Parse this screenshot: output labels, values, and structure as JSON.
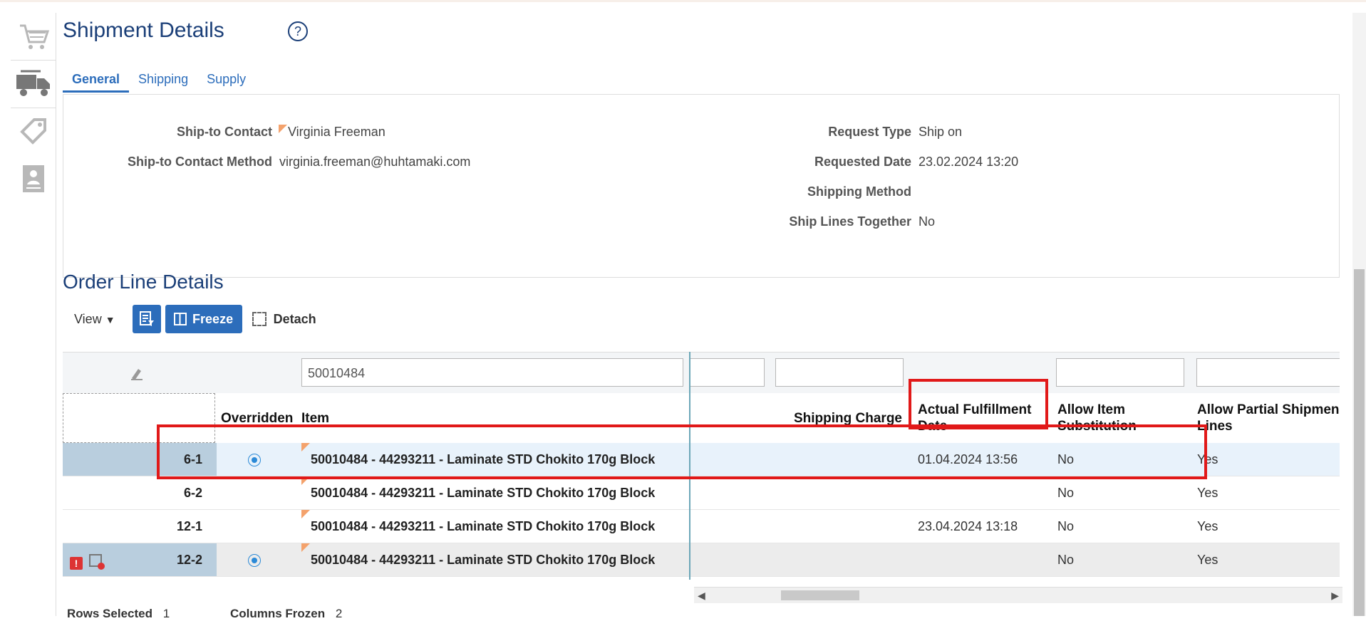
{
  "page": {
    "title": "Shipment Details",
    "help": "?"
  },
  "tabs": {
    "general": "General",
    "shipping": "Shipping",
    "supply": "Supply"
  },
  "details": {
    "ship_to_contact_label": "Ship-to Contact",
    "ship_to_contact_value": "Virginia Freeman",
    "ship_to_contact_method_label": "Ship-to Contact Method",
    "ship_to_contact_method_value": "virginia.freeman@huhtamaki.com",
    "request_type_label": "Request Type",
    "request_type_value": "Ship on",
    "requested_date_label": "Requested Date",
    "requested_date_value": "23.02.2024 13:20",
    "shipping_method_label": "Shipping Method",
    "ship_lines_together_label": "Ship Lines Together",
    "ship_lines_together_value": "No"
  },
  "order_lines": {
    "title": "Order Line Details",
    "toolbar": {
      "view": "View",
      "freeze": "Freeze",
      "detach": "Detach"
    },
    "filter": {
      "item_value": "50010484"
    },
    "headers": {
      "overridden": "Overridden",
      "item": "Item",
      "shipping_charge": "Shipping Charge",
      "actual_fulfillment_date_1": "Actual Fulfillment",
      "actual_fulfillment_date_2": "Date",
      "allow_item_substitution_1": "Allow Item",
      "allow_item_substitution_2": "Substitution",
      "allow_partial_shipment_1": "Allow Partial Shipmen",
      "allow_partial_shipment_2": "Lines"
    },
    "rows": [
      {
        "line": "6-1",
        "item": "50010484 - 44293211 - Laminate STD Chokito 170g Block",
        "fulfillment": "01.04.2024 13:56",
        "substitution": "No",
        "partial": "Yes"
      },
      {
        "line": "6-2",
        "item": "50010484 - 44293211 - Laminate STD Chokito 170g Block",
        "fulfillment": "",
        "substitution": "No",
        "partial": "Yes"
      },
      {
        "line": "12-1",
        "item": "50010484 - 44293211 - Laminate STD Chokito 170g Block",
        "fulfillment": "23.04.2024 13:18",
        "substitution": "No",
        "partial": "Yes"
      },
      {
        "line": "12-2",
        "item": "50010484 - 44293211 - Laminate STD Chokito 170g Block",
        "fulfillment": "",
        "substitution": "No",
        "partial": "Yes"
      }
    ],
    "footer": {
      "rows_selected_label": "Rows Selected",
      "rows_selected_value": "1",
      "columns_frozen_label": "Columns Frozen",
      "columns_frozen_value": "2"
    }
  }
}
